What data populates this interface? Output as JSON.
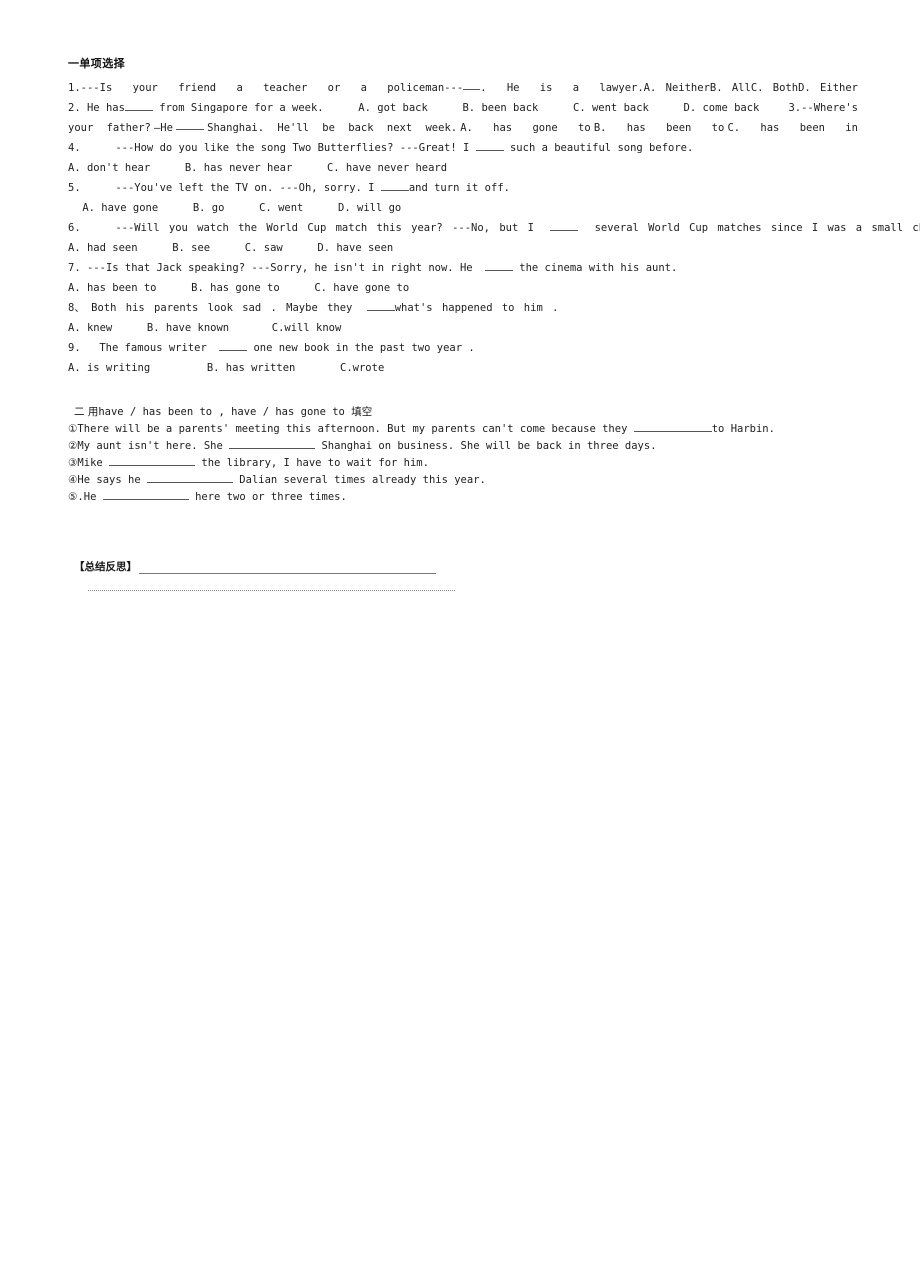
{
  "document": {
    "section_one": {
      "heading": "一单项选择",
      "questions": [
        {
          "id": "q1",
          "number": "1.",
          "stem_left": "---Is  your  friend  a  teacher  or  a  policeman",
          "dash": "---",
          "stem_right": ".  He  is  a  lawyer.",
          "options_inline": [
            "A.  Neither",
            "B.  All",
            "C.  Both",
            "D.  Either"
          ]
        },
        {
          "id": "q2",
          "number": "2.",
          "stem_a": "He has",
          "stem_b": "from Singapore for a week.",
          "options_inline": [
            "A. got back",
            "B. been back",
            "C. went back",
            "D. come back"
          ],
          "trailing": "3.--Where's"
        },
        {
          "id": "q3",
          "continuation_a": "your   father?",
          "continuation_dash": "—He",
          "continuation_b": "Shanghai.  He'll  be  back  next  week.",
          "options_inline": [
            "A.  has  gone  to",
            "B.  has  been  to",
            "C.  has  been  in"
          ]
        },
        {
          "id": "q4",
          "number": "4.",
          "stem_a": "---How do you like the song Two Butterflies?    ---Great! I",
          "stem_b": "such a beautiful song before.",
          "options_line": [
            "A. don't hear",
            "B. has never hear",
            "C. have never heard"
          ]
        },
        {
          "id": "q5",
          "number": "5.",
          "stem_a": "---You've left the TV on. ---Oh, sorry. I",
          "stem_b": "and turn it off.",
          "options_line": [
            "A. have gone",
            "B. go",
            "C. went",
            "D. will go"
          ]
        },
        {
          "id": "q6",
          "number": "6.",
          "stem_a": "---Will  you  watch  the  World  Cup  match  this  year?     ---No,  but  I",
          "stem_b": "several  World  Cup  matches  since  I  was  a  small  child.",
          "options_line": [
            "A. had seen",
            "B. see",
            "C. saw",
            "D. have seen"
          ]
        },
        {
          "id": "q7",
          "number": "7.",
          "stem_a": "---Is that Jack speaking?   ---Sorry, he isn't in right now. He",
          "stem_b": "the cinema with his aunt.",
          "options_line": [
            "A. has been to",
            "B. has gone to",
            "C. have gone to"
          ]
        },
        {
          "id": "q8",
          "number": "8、",
          "stem_a": "Both  his  parents  look  sad .  Maybe  they",
          "stem_b": "what's  happened  to  him .",
          "options_line": [
            "A.   knew",
            "B.   have known",
            "C.will know"
          ]
        },
        {
          "id": "q9",
          "number": "9.",
          "stem_a": "The famous writer",
          "stem_b": "one new book in the past two year .",
          "options_line": [
            "A. is  writing",
            "B. has  written",
            "C.wrote"
          ]
        }
      ]
    },
    "section_two": {
      "heading_prefix": "二 ",
      "heading_cjk_use": "用",
      "heading_en": "have / has been to , have / has gone to ",
      "heading_cjk_fill": "填空",
      "items": [
        {
          "id": "f1",
          "marker": "①",
          "text_before": "There will be a parents'  meeting this afternoon. But my parents can't come because they",
          "text_after": "to Harbin."
        },
        {
          "id": "f2",
          "marker": "②",
          "text_before": "My aunt isn't here. She",
          "text_after": "Shanghai on business. She will be back in three days."
        },
        {
          "id": "f3",
          "marker": "③",
          "text_before": "Mike",
          "text_after": "the library, I have to wait for him."
        },
        {
          "id": "f4",
          "marker": "④",
          "text_before": "He says he",
          "text_after": "Dalian several times already this year."
        },
        {
          "id": "f5",
          "marker": "⑤.",
          "text_before": "He",
          "text_after": "here two or three times."
        }
      ]
    },
    "reflection": {
      "label": "【总结反思】"
    }
  },
  "colors": {
    "page_background": "#ffffff",
    "text": "#1d1d1d",
    "rule": "#777777",
    "dotted_rule": "#8a8a8a"
  }
}
